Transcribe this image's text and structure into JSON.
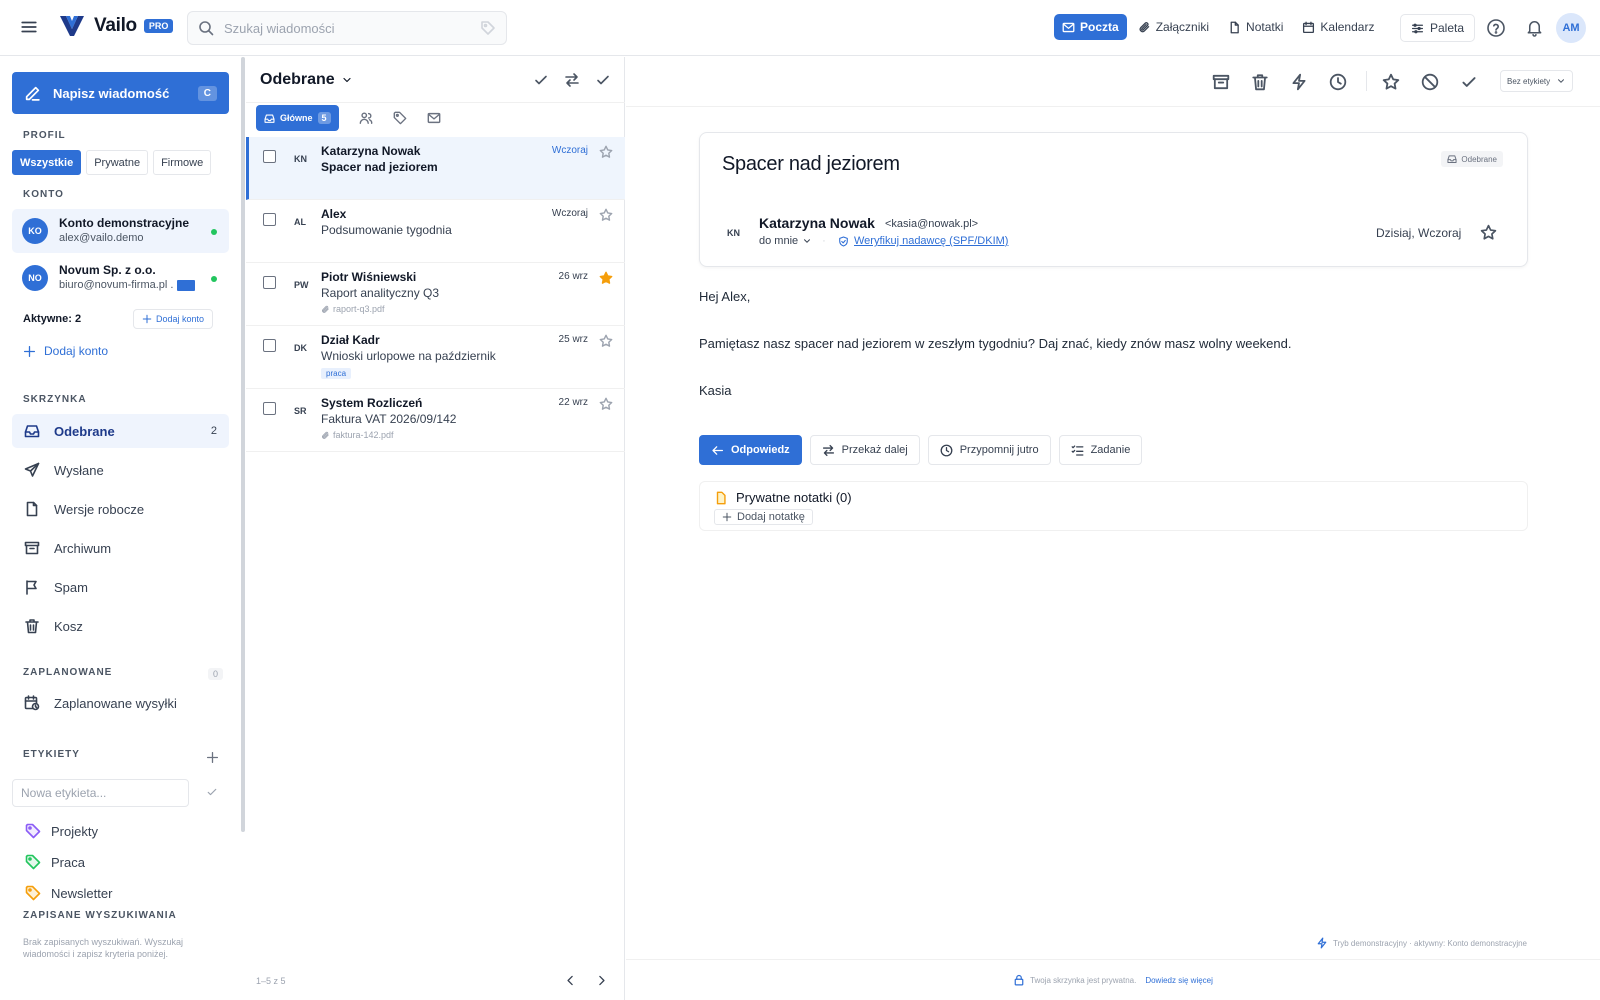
{
  "app": {
    "name": "Vailo",
    "badge": "PRO"
  },
  "search": {
    "placeholder": "Szukaj wiadomości"
  },
  "nav": [
    {
      "label": "Poczta",
      "icon": "mail-icon",
      "active": true
    },
    {
      "label": "Załączniki",
      "icon": "paperclip-icon"
    },
    {
      "label": "Notatki",
      "icon": "note-icon"
    },
    {
      "label": "Kalendarz",
      "icon": "calendar-icon"
    }
  ],
  "palette": {
    "label": "Paleta"
  },
  "user": {
    "initials": "AM"
  },
  "sidebar": {
    "compose": {
      "label": "Napisz wiadomość",
      "shortcut": "C"
    },
    "profile_title": "PROFIL",
    "profile_tabs": [
      "Wszystkie",
      "Prywatne",
      "Firmowe"
    ],
    "account_title": "KONTO",
    "accounts": [
      {
        "initials": "KO",
        "name": "Konto demonstracyjne",
        "email": "alex@vailo.demo"
      },
      {
        "initials": "NO",
        "name": "Novum Sp. z o.o.",
        "email": "biuro@novum-firma.pl ."
      }
    ],
    "active_count": "Aktywne: 2",
    "add_account_small": "Dodaj konto",
    "add_account": "Dodaj konto",
    "mailbox_title": "SKRZYNKA",
    "folders": [
      {
        "label": "Odebrane",
        "count": "2",
        "icon": "inbox-icon"
      },
      {
        "label": "Wysłane",
        "icon": "send-icon"
      },
      {
        "label": "Wersje robocze",
        "icon": "draft-icon"
      },
      {
        "label": "Archiwum",
        "icon": "archive-icon"
      },
      {
        "label": "Spam",
        "icon": "flag-icon"
      },
      {
        "label": "Kosz",
        "icon": "trash-icon"
      }
    ],
    "scheduled_title": "ZAPLANOWANE",
    "scheduled_count": "0",
    "scheduled_item": "Zaplanowane wysyłki",
    "labels_title": "ETYKIETY",
    "label_placeholder": "Nowa etykieta...",
    "labels": [
      {
        "name": "Projekty",
        "color": "#8b5cf6"
      },
      {
        "name": "Praca",
        "color": "#22c55e"
      },
      {
        "name": "Newsletter",
        "color": "#f59e0b"
      }
    ],
    "saved_title": "ZAPISANE WYSZUKIWANIA",
    "saved_empty": "Brak zapisanych wyszukiwań. Wyszukaj wiadomości i zapisz kryteria poniżej."
  },
  "list": {
    "title": "Odebrane",
    "main_tab": "Główne",
    "main_count": "5",
    "messages": [
      {
        "initials": "KN",
        "from": "Katarzyna Nowak",
        "subject": "Spacer nad jeziorem",
        "date": "Wczoraj",
        "starred": false
      },
      {
        "initials": "AL",
        "from": "Alex",
        "subject": "Podsumowanie tygodnia",
        "date": "Wczoraj",
        "starred": false
      },
      {
        "initials": "PW",
        "from": "Piotr Wiśniewski",
        "subject": "Raport analityczny Q3",
        "date": "26 wrz",
        "starred": true,
        "attachment": "raport-q3.pdf"
      },
      {
        "initials": "DK",
        "from": "Dział Kadr",
        "subject": "Wnioski urlopowe na październik",
        "date": "25 wrz",
        "starred": false,
        "tag": "praca"
      },
      {
        "initials": "SR",
        "from": "System Rozliczeń",
        "subject": "Faktura VAT 2026/09/142",
        "date": "22 wrz",
        "starred": false,
        "attachment": "faktura-142.pdf"
      }
    ],
    "footer": "1–5 z 5"
  },
  "reader": {
    "label_select": "Bez etykiety",
    "subject": "Spacer nad jeziorem",
    "folder_badge": "Odebrane",
    "sender_initials": "KN",
    "sender_name": "Katarzyna Nowak",
    "sender_email": "<kasia@nowak.pl>",
    "to": "do mnie",
    "verify": "Weryfikuj nadawcę (SPF/DKIM)",
    "date": "Dzisiaj, Wczoraj",
    "body": [
      "Hej Alex,",
      "Pamiętasz nasz spacer nad jeziorem w zeszłym tygodniu? Daj znać, kiedy znów masz wolny weekend.",
      "Kasia"
    ],
    "actions": [
      "Odpowiedz",
      "Przekaż dalej",
      "Przypomnij jutro",
      "Zadanie"
    ],
    "notes_title": "Prywatne notatki (0)",
    "notes_add": "Dodaj notatkę",
    "demo_note": "Tryb demonstracyjny · aktywny: Konto demonstracyjne",
    "footer_text": "Twoja skrzynka jest prywatna.",
    "footer_link": "Dowiedz się więcej"
  },
  "colors": {
    "accent": "#2f6fd6",
    "star": "#f59e0b",
    "online": "#22c55e"
  }
}
